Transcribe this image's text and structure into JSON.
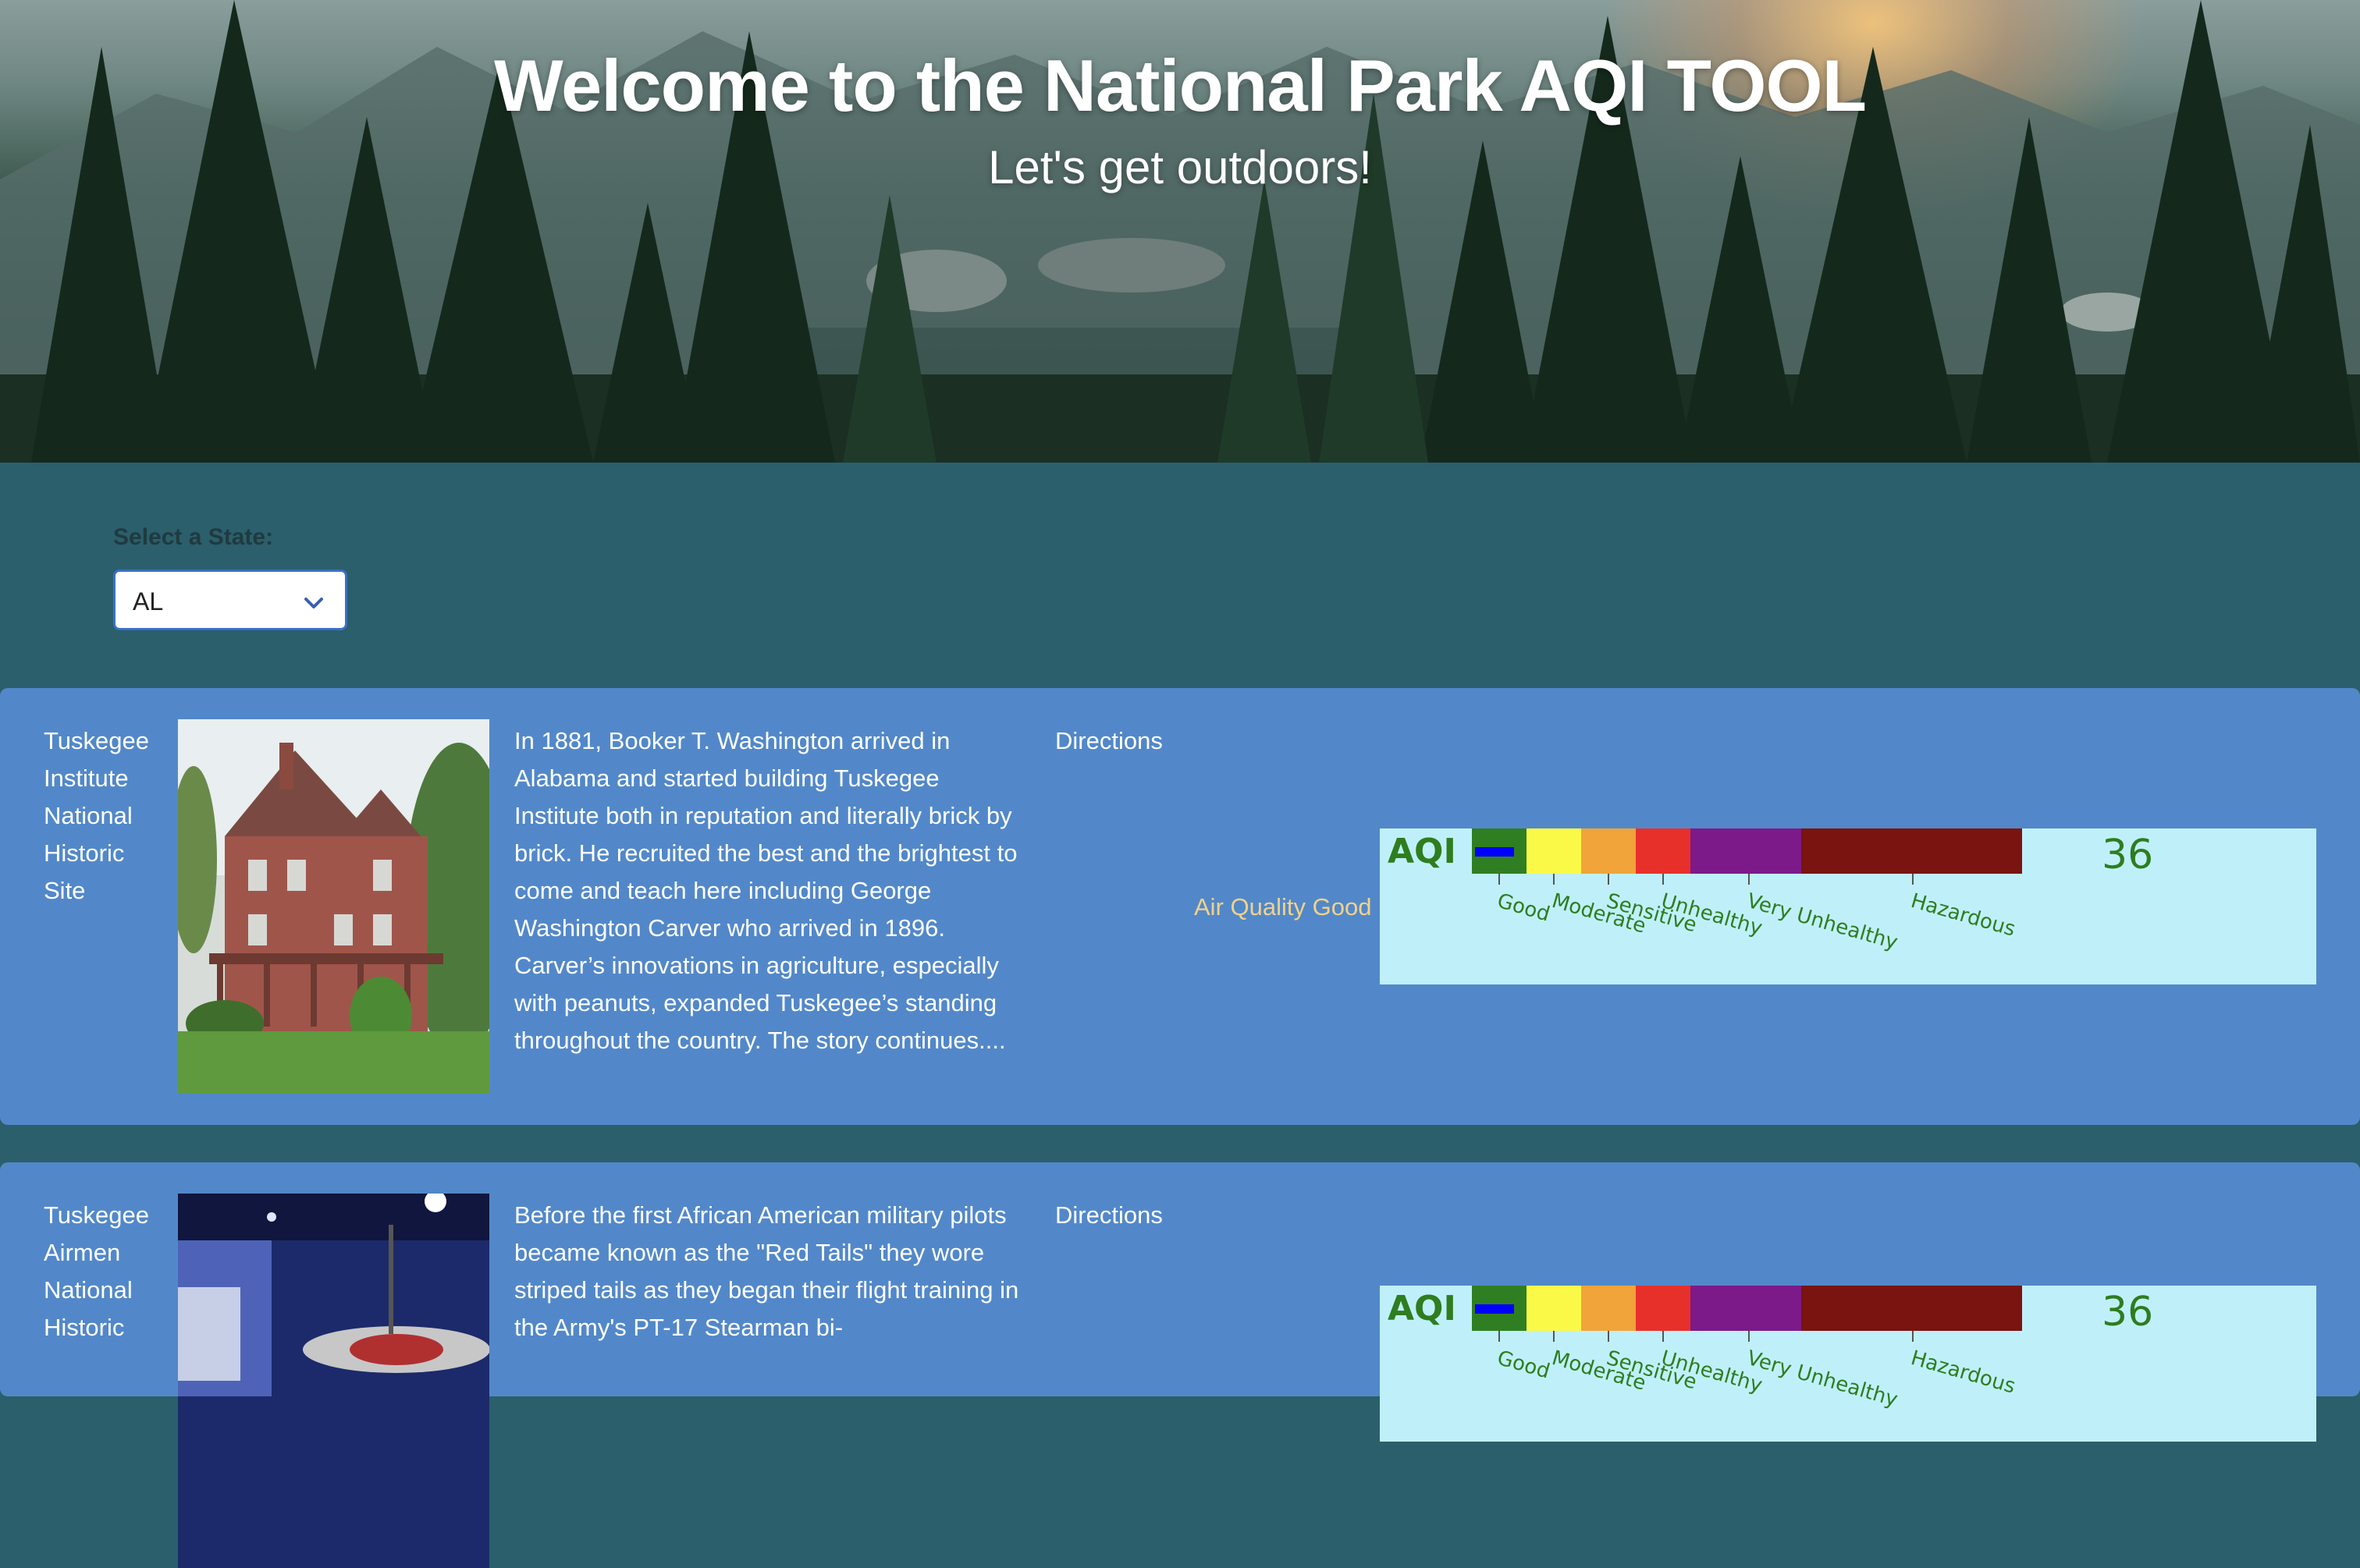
{
  "header": {
    "title": "Welcome to the National Park AQI TOOL",
    "subtitle": "Let's get outdoors!"
  },
  "state_selector": {
    "label": "Select a State:",
    "value": "AL"
  },
  "aqi_scale": {
    "label": "AQI",
    "categories": [
      {
        "name": "Good",
        "color": "#2f7f22"
      },
      {
        "name": "Moderate",
        "color": "#fbf948"
      },
      {
        "name": "Sensitive",
        "color": "#f0a43a"
      },
      {
        "name": "Unhealthy",
        "color": "#e8302a"
      },
      {
        "name": "Very Unhealthy",
        "color": "#7c1a8a"
      },
      {
        "name": "Hazardous",
        "color": "#7a1410"
      }
    ],
    "marker_color": "#0000ff",
    "text_color": "#2e7d1e",
    "panel_color": "#bff0fa"
  },
  "parks": [
    {
      "name": "Tuskegee Institute National Historic Site",
      "description": "In 1881, Booker T. Washington arrived in Alabama and started building Tuskegee Institute both in reputation and literally brick by brick. He recruited the best and the brightest to come and teach here including George Washington Carver who arrived in 1896. Carver’s innovations in agriculture, especially with peanuts, expanded Tuskegee’s standing throughout the country. The story continues....",
      "directions": "Directions",
      "air_quality": "Air Quality Good",
      "aqi": 36
    },
    {
      "name": "Tuskegee Airmen National Historic",
      "description": "Before the first African American military pilots became known as the \"Red Tails\" they wore striped tails as they began their flight training in the Army's PT-17 Stearman bi-",
      "directions": "Directions",
      "aqi": 36
    }
  ]
}
